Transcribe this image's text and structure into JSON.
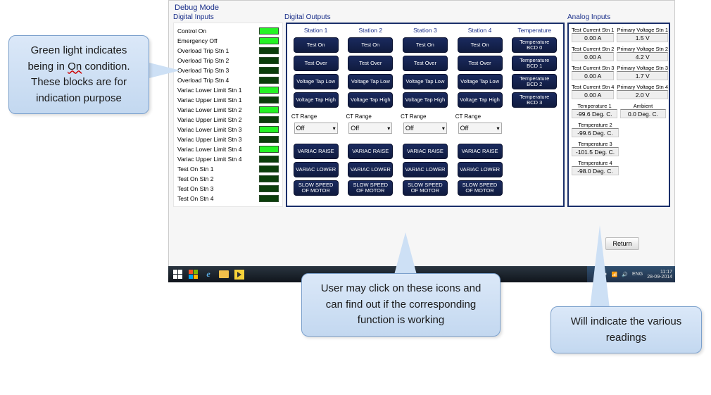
{
  "title": "Debug Mode",
  "sections": {
    "di": "Digital Inputs",
    "do": "Digital Outputs",
    "ai": "Analog Inputs"
  },
  "digital_inputs": [
    {
      "label": "Control On",
      "on": true
    },
    {
      "label": "Emergency Off",
      "on": true
    },
    {
      "label": "Overload Trip Stn 1",
      "on": false
    },
    {
      "label": "Overload Trip Stn 2",
      "on": false
    },
    {
      "label": "Overload Trip Stn 3",
      "on": false
    },
    {
      "label": "Overload Trip Stn 4",
      "on": false
    },
    {
      "label": "Variac Lower Limit Stn 1",
      "on": true
    },
    {
      "label": "Variac Upper Limit Stn 1",
      "on": false
    },
    {
      "label": "Variac Lower Limit Stn 2",
      "on": true
    },
    {
      "label": "Variac Upper Limit Stn 2",
      "on": false
    },
    {
      "label": "Variac Lower Limit Stn 3",
      "on": true
    },
    {
      "label": "Variac Upper Limit Stn 3",
      "on": false
    },
    {
      "label": "Variac Lower Limit Stn 4",
      "on": true
    },
    {
      "label": "Variac Upper Limit Stn 4",
      "on": false
    },
    {
      "label": "Test On Stn 1",
      "on": false
    },
    {
      "label": "Test On Stn 2",
      "on": false
    },
    {
      "label": "Test On Stn 3",
      "on": false
    },
    {
      "label": "Test On Stn 4",
      "on": false
    }
  ],
  "do_station_headers": [
    "Station 1",
    "Station 2",
    "Station 3",
    "Station 4",
    "Temperature"
  ],
  "do_station_buttons": [
    "Test On",
    "Test Over",
    "Voltage Tap Low",
    "Voltage Tap High"
  ],
  "ct_label": "CT Range",
  "ct_value": "Off",
  "do_extra_buttons": [
    "VARIAC RAISE",
    "VARIAC LOWER",
    "SLOW SPEED OF MOTOR"
  ],
  "do_temp_buttons": [
    "Temperature BCD 0",
    "Temperature BCD 1",
    "Temperature BCD 2",
    "Temperature BCD 3"
  ],
  "analog_pairs": [
    {
      "l_label": "Test Current Stn 1",
      "l_val": "0.00 A",
      "r_label": "Primary Voltage Stn 1",
      "r_val": "1.5 V"
    },
    {
      "l_label": "Test Current Stn 2",
      "l_val": "0.00 A",
      "r_label": "Primary Voltage Stn 2",
      "r_val": "4.2 V"
    },
    {
      "l_label": "Test Current Stn 3",
      "l_val": "0.00 A",
      "r_label": "Primary Voltage Stn 3",
      "r_val": "1.7 V"
    },
    {
      "l_label": "Test Current Stn 4",
      "l_val": "0.00 A",
      "r_label": "Primary Voltage Stn 4",
      "r_val": "2.0 V"
    },
    {
      "l_label": "Temperature 1",
      "l_val": "-99.6 Deg. C.",
      "r_label": "Ambient",
      "r_val": "0.0 Deg. C."
    }
  ],
  "analog_singles": [
    {
      "label": "Temperature 2",
      "val": "-99.6 Deg. C."
    },
    {
      "label": "Temperature 3",
      "val": "-101.5 Deg. C."
    },
    {
      "label": "Temperature 4",
      "val": "-98.0 Deg. C."
    }
  ],
  "return_label": "Return",
  "taskbar": {
    "lang": "ENG",
    "time": "11:17",
    "date": "28-09-2014"
  },
  "callouts": {
    "left_a": "Green light indicates being in ",
    "left_on": "On",
    "left_b": " condition. These blocks are for indication purpose",
    "center": "User may click on these icons and can find out if the corresponding function is working",
    "right": "Will indicate the various readings"
  }
}
